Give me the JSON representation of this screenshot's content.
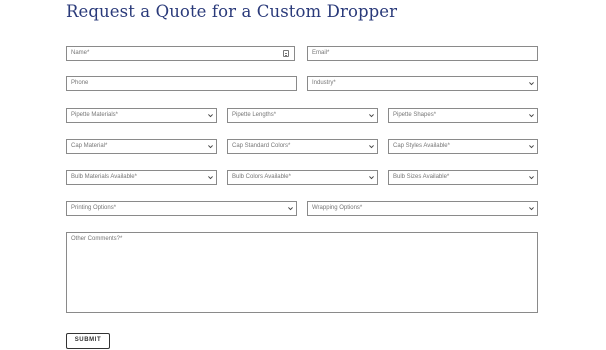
{
  "form": {
    "title": "Request a Quote for a Custom Dropper",
    "name_placeholder": "Name*",
    "email_placeholder": "Email*",
    "phone_placeholder": "Phone",
    "industry_placeholder": "Industry*",
    "pipette_materials": "Pipette Materials*",
    "pipette_lengths": "Pipette Lengths*",
    "pipette_shapes": "Pipette Shapes*",
    "cap_material": "Cap Material*",
    "cap_standard_colors": "Cap Standard Colors*",
    "cap_styles": "Cap Styles Available*",
    "bulb_materials": "Bulb Materials Available*",
    "bulb_colors": "Bulb Colors Available*",
    "bulb_sizes": "Bulb Sizes Available*",
    "printing_options": "Printing Options*",
    "wrapping_options": "Wrapping Options*",
    "comments_placeholder": "Other Comments?*",
    "submit_label": "SUBMIT"
  },
  "icons": {
    "dropdown": "chevron-down-icon",
    "autofill": "contact-card-icon"
  },
  "colors": {
    "title": "#2a3a7a",
    "border": "#8a8a8a"
  }
}
